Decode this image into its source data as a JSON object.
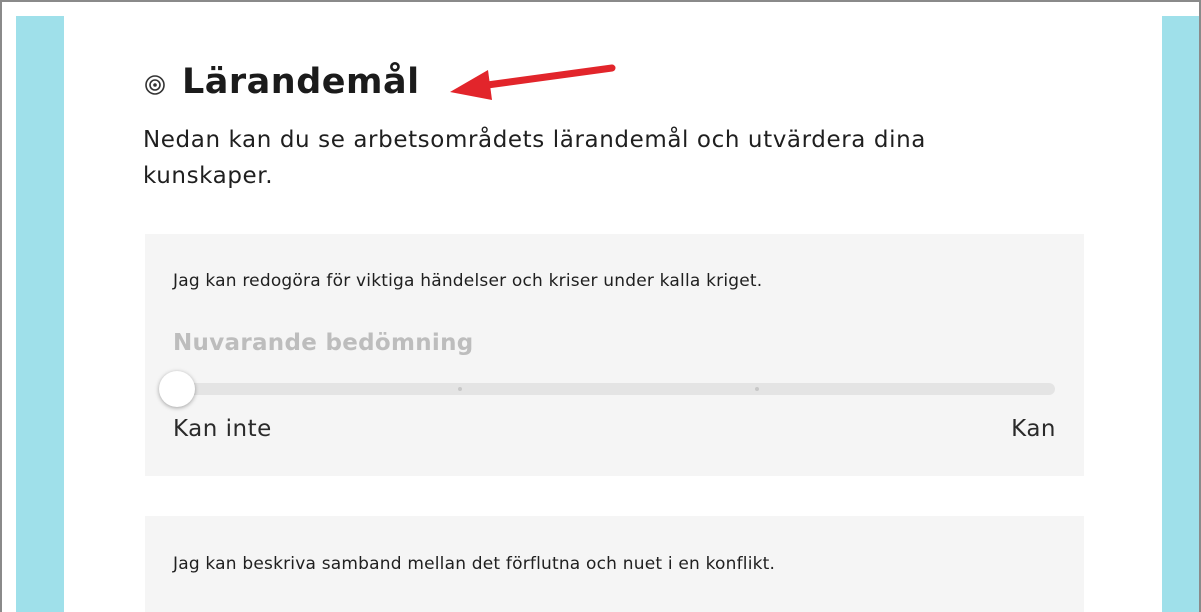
{
  "section": {
    "title": "Lärandemål",
    "icon": "target-icon",
    "intro": "Nedan kan du se arbetsområdets lärandemål och utvärdera dina kunskaper."
  },
  "annotation": {
    "arrow_color": "#e2252b"
  },
  "colors": {
    "side_panel": "#9fe0ea",
    "card_bg": "#f5f5f5",
    "track": "#e4e4e4"
  },
  "goals": [
    {
      "text": "Jag kan redogöra för viktiga händelser och kriser under kalla kriget.",
      "rating_label": "Nuvarande bedömning",
      "slider": {
        "min_label": "Kan inte",
        "max_label": "Kan",
        "value": 0,
        "steps": 3
      }
    },
    {
      "text": "Jag kan beskriva samband mellan det förflutna och nuet i en konflikt."
    }
  ]
}
